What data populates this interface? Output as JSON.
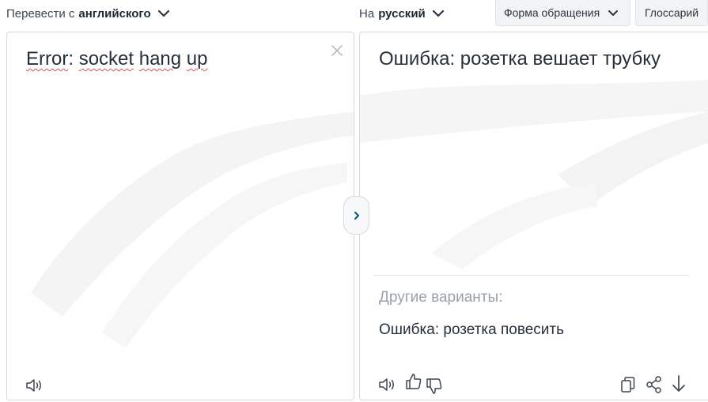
{
  "source_language": {
    "prefix": "Перевести с",
    "name": "английского",
    "icon": "chevron-down-icon"
  },
  "target_language": {
    "prefix": "На",
    "name": "русский",
    "icon": "chevron-down-icon"
  },
  "toolbar": {
    "formality_label": "Форма обращения",
    "glossary_label": "Глоссарий"
  },
  "source": {
    "word1": "Error",
    "sep": ":",
    "word2": "socket",
    "word3": "hang",
    "word4": "up",
    "clear_icon": "close-icon",
    "speaker_icon": "speaker-icon"
  },
  "target": {
    "text": "Ошибка: розетка вешает трубку",
    "alternatives_label": "Другие варианты:",
    "alternatives": [
      "Ошибка: розетка повесить"
    ],
    "icons": [
      "speaker-icon",
      "thumbs-up-icon",
      "thumbs-down-icon",
      "copy-icon",
      "share-icon",
      "download-icon"
    ]
  },
  "swap_icon": "chevron-right-icon",
  "colors": {
    "accent": "#0f5d7a",
    "text": "#26303a",
    "muted": "#9aa2a9",
    "border": "#d6dade"
  }
}
